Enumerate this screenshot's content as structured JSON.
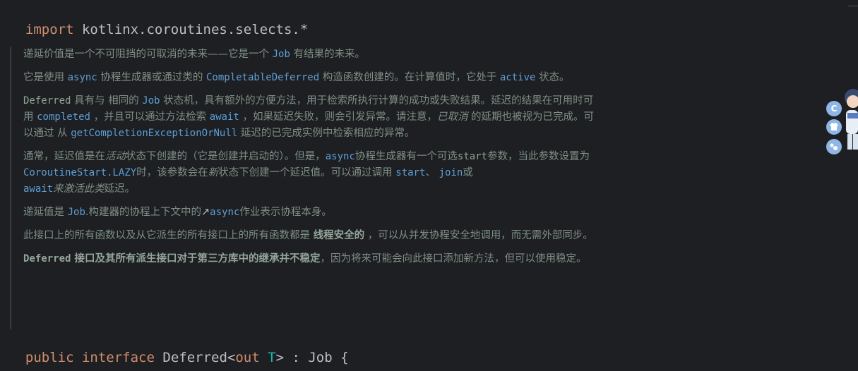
{
  "import_line": {
    "keyword": "import",
    "path": " kotlinx.coroutines.selects.*"
  },
  "doc": {
    "p1": {
      "t1": "递延价值是一个不可阻挡的可取消的未来——它是一个 ",
      "c1": "Job",
      "t2": " 有结果的未来。"
    },
    "p2": {
      "t1": "它是使用 ",
      "c1": "async",
      "t2": " 协程生成器或通过类的 ",
      "c2": "CompletableDeferred",
      "t3": " 构造函数创建的。在计算值时，它处于 ",
      "c3": "active",
      "t4": " 状态。"
    },
    "p3": {
      "c0": "Deferred",
      "t1": " 具有与 相同的 ",
      "c1": "Job",
      "t2": " 状态机，具有额外的方便方法，用于检索所执行计算的成功或失败结果。延迟的结果在可用时可用 ",
      "c2": "completed",
      "t3": " ，并且可以通过方法检索 ",
      "c3": "await",
      "t4": " ，如果延迟失败，则会引发异常。请注意，",
      "i1": "已取消",
      "t5": " 的延期也被视为已完成。可以通过 从 ",
      "c4": "getCompletionExceptionOrNull",
      "t6": " 延迟的已完成实例中检索相应的异常。"
    },
    "p4": {
      "t1": "通常，延迟值是在",
      "i1": "活动",
      "t2": "状态下创建的（它是创建并启动的）。但是，",
      "c1": "async",
      "t3": "协程生成器有一个可选",
      "c2": "start",
      "t4": "参数，当此参数设置为 ",
      "c3": "CoroutineStart.LAZY",
      "t5": "时，该参数会在",
      "i2": "新",
      "t6": "状态下创建一个延迟值。可以通过调用 ",
      "c4": "start",
      "t7": "、 ",
      "c5": "join",
      "t8": "或",
      "c6": "await",
      "i3": "来激活此类",
      "t9": "延迟。"
    },
    "p5": {
      "t1": "递延值是 ",
      "c1": "Job",
      "t2": ".构建器的协程上下文中的",
      "arrow": "↗",
      "c2": "async",
      "t3": "作业表示协程本身。"
    },
    "p6": {
      "t1": "此接口上的所有函数以及从它派生的所有接口上的所有函数都是 ",
      "b1": "线程安全的",
      "t2": " ，可以从并发协程安全地调用，而无需外部同步。"
    },
    "p7": {
      "c1": "Deferred",
      "b1": " 接口及其所有派生接口对于第三方库中的继承并不稳定",
      "t1": "，因为将来可能会向此接口添加新方法，但可以使用稳定。"
    }
  },
  "decl_line": {
    "kw1": "public",
    "kw2": "interface",
    "name": "Deferred<",
    "kw3": "out",
    "type_param": "T",
    "rest": "> : Job {"
  },
  "side_widget": {
    "btn1": "C",
    "btn2_icon": "shirt-icon",
    "btn3_icon": "dots-icon"
  },
  "colors": {
    "background": "#1e1f22",
    "keyword": "#cf8e6d",
    "doc_text": "#7e8f86",
    "doc_code_link": "#5c9fd6",
    "type_param": "#16baac"
  }
}
